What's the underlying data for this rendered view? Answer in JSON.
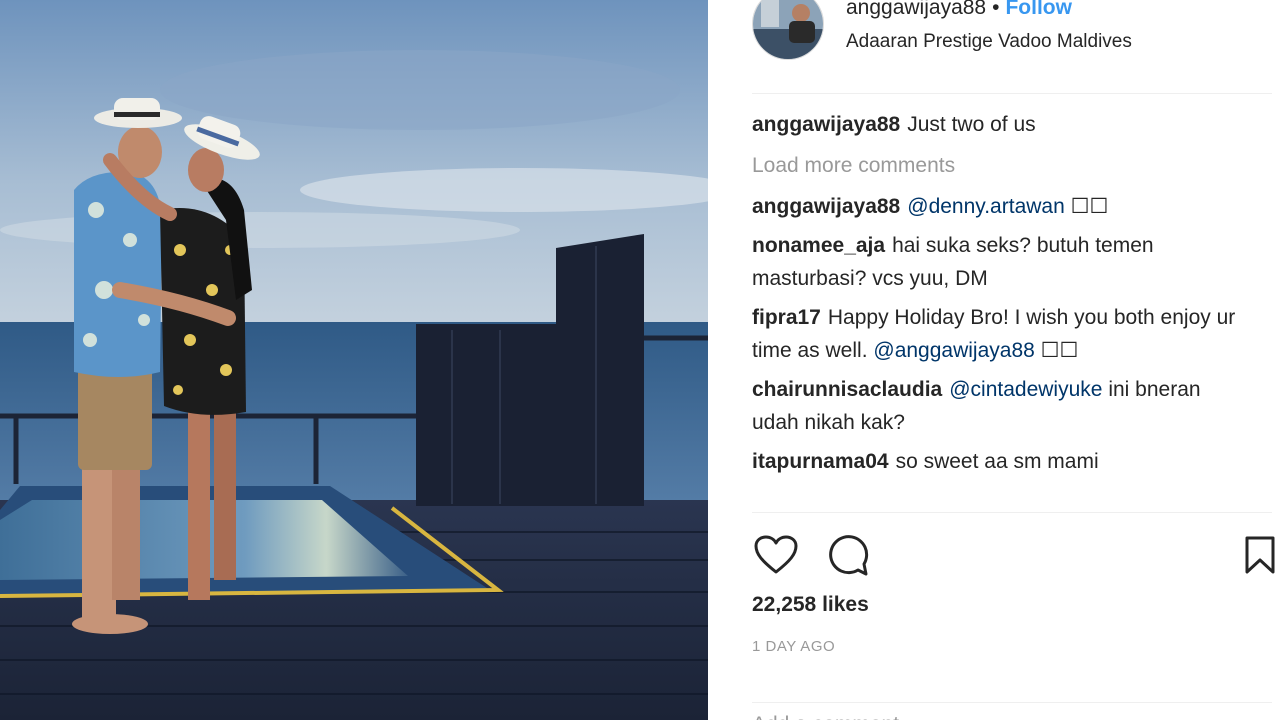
{
  "post": {
    "image_alt": "",
    "author": {
      "username": "anggawijaya88",
      "separator": "•",
      "follow_label": "Follow",
      "location": "Adaaran Prestige Vadoo Maldives",
      "avatar_icon": "avatar-photo"
    },
    "caption": {
      "username": "anggawijaya88",
      "text": "Just two of us"
    },
    "load_more_label": "Load more comments",
    "comments": [
      {
        "username": "anggawijaya88",
        "mention": "@denny.artawan",
        "text": "",
        "suffix": " ☐☐"
      },
      {
        "username": "nonamee_aja",
        "mention": "",
        "text": "hai suka seks? butuh temen masturbasi? vcs yuu, DM",
        "suffix": ""
      },
      {
        "username": "fipra17",
        "mention": "@anggawijaya88",
        "text": "Happy Holiday Bro! I wish you both enjoy ur time as well.",
        "suffix": " ☐☐"
      },
      {
        "username": "chairunnisaclaudia",
        "mention": "@cintadewiyuke",
        "text": "ini bneran udah nikah kak?",
        "suffix": ""
      },
      {
        "username": "itapurnama04",
        "mention": "",
        "text": "so sweet aa sm mami",
        "suffix": ""
      }
    ],
    "actions": {
      "like_icon": "heart-icon",
      "comment_icon": "comment-icon",
      "save_icon": "bookmark-icon"
    },
    "likes_label": "22,258 likes",
    "timestamp": "1 DAY AGO",
    "add_comment_placeholder": "Add a comment..."
  },
  "colors": {
    "link_blue": "#3897f0",
    "mention_blue": "#003569",
    "muted_gray": "#999999",
    "text": "#262626",
    "divider": "#efefef"
  }
}
